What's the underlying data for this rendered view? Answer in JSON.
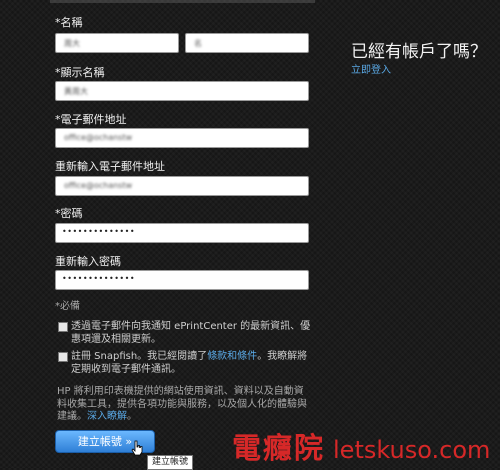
{
  "form": {
    "name_label": "*名稱",
    "first_name_value": "周大",
    "last_name_value": "名",
    "display_name_label": "*顯示名稱",
    "display_name_value": "黃周大",
    "email_label": "*電子郵件地址",
    "email_value": "office@ochanstw",
    "email_confirm_label": "重新輸入電子郵件地址",
    "email_confirm_value": "office@ochanstw",
    "password_label": "*密碼",
    "password_value": "••••••••••••••",
    "password_confirm_label": "重新輸入密碼",
    "password_confirm_value": "••••••••••••••",
    "required_note": "*必備",
    "checkbox1_text": "透過電子郵件向我通知 ePrintCenter 的最新資訊、優惠項還及相關更新。",
    "checkbox2_prefix": "註冊 Snapfish。我已經閱讀了",
    "checkbox2_link": "條款和條件",
    "checkbox2_suffix": "。我瞭解將定期收到電子郵件通訊。",
    "privacy_text": "HP 將利用印表機提供的網站使用資訊、資料以及自動資料收集工具，提供各項功能與服務，以及個人化的體驗與建議。",
    "privacy_link": "深入瞭解",
    "privacy_link_suffix": "。",
    "submit_label": "建立帳號 »",
    "tooltip": "建立帳號"
  },
  "sidebar": {
    "title": "已經有帳戶了嗎？",
    "login_link": "立即登入"
  },
  "watermark": {
    "cn": "電癮院",
    "en": "letskuso.com"
  },
  "colors": {
    "link": "#5aa9e6",
    "button": "#3b8fe6",
    "watermark": "#d62828"
  }
}
